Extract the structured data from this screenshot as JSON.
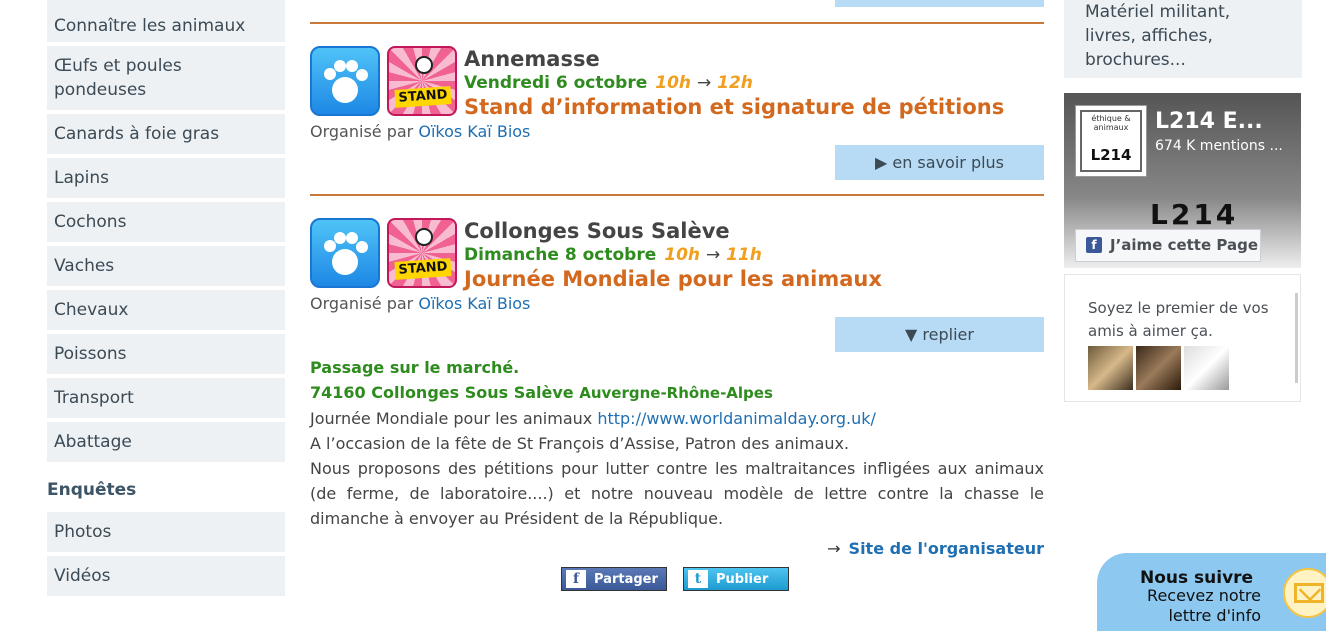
{
  "sidebar": {
    "items": [
      {
        "label": "Connaître les animaux"
      },
      {
        "label": "Œufs et poules pondeuses"
      },
      {
        "label": "Canards à foie gras"
      },
      {
        "label": "Lapins"
      },
      {
        "label": "Cochons"
      },
      {
        "label": "Vaches"
      },
      {
        "label": "Chevaux"
      },
      {
        "label": "Poissons"
      },
      {
        "label": "Transport"
      },
      {
        "label": "Abattage"
      }
    ],
    "section_heading": "Enquêtes",
    "section_items": [
      {
        "label": "Photos"
      },
      {
        "label": "Vidéos"
      }
    ]
  },
  "events": [
    {
      "city": "Annemasse",
      "date": "Vendredi 6 octobre",
      "time_start": "10h",
      "time_arrow": "→",
      "time_end": "12h",
      "title": "Stand d’information et signature de pétitions",
      "organized_by": "Organisé par",
      "organizer": "Oïkos Kaï Bios",
      "stand_label": "STAND",
      "toggle_label": "▶ en savoir plus"
    },
    {
      "city": "Collonges Sous Salève",
      "date": "Dimanche 8 octobre",
      "time_start": "10h",
      "time_arrow": "→",
      "time_end": "11h",
      "title": "Journée Mondiale pour les animaux",
      "organized_by": "Organisé par",
      "organizer": "Oïkos Kaï Bios",
      "stand_label": "STAND",
      "toggle_label": "▼ replier"
    }
  ],
  "details": {
    "place": "Passage sur le marché.",
    "postal_city": "74160 Collonges Sous Salève",
    "region": "Auvergne-Rhône-Alpes",
    "line1_text": "Journée Mondiale pour les animaux",
    "line1_link": "http://www.worldanimalday.org.uk/",
    "line2": "A l’occasion de la fête de St François d’Assise, Patron des animaux.",
    "line3": "Nous proposons des pétitions pour lutter contre les maltraitances infligées aux animaux (de ferme, de laboratoire....) et notre nouveau modèle de lettre contre la chasse le dimanche à envoyer au Président de la République.",
    "org_site_arrow": "→",
    "org_site": "Site de l'organisateur"
  },
  "share": {
    "facebook_glyph": "f",
    "facebook_label": "Partager",
    "twitter_glyph": "t",
    "twitter_label": "Publier"
  },
  "right": {
    "material_text": "Matériel militant, livres, affiches, brochures...",
    "fb": {
      "thumb_top": "éthique & animaux",
      "thumb_logo": "L214",
      "page_name": "L214 E...",
      "likes": "674 K mentions ...",
      "cover_logo": "L214",
      "like_glyph": "f",
      "like_button": "J’aime cette Page",
      "friends_text": "Soyez le premier de vos amis à aimer ça."
    }
  },
  "follow": {
    "title": "Nous suivre",
    "subtitle": "Recevez notre lettre d'info"
  },
  "colors": {
    "accent_orange": "#d2691e",
    "date_green": "#2e8b1e",
    "link_blue": "#1f6fb2",
    "button_blue": "#b8dbf5"
  }
}
